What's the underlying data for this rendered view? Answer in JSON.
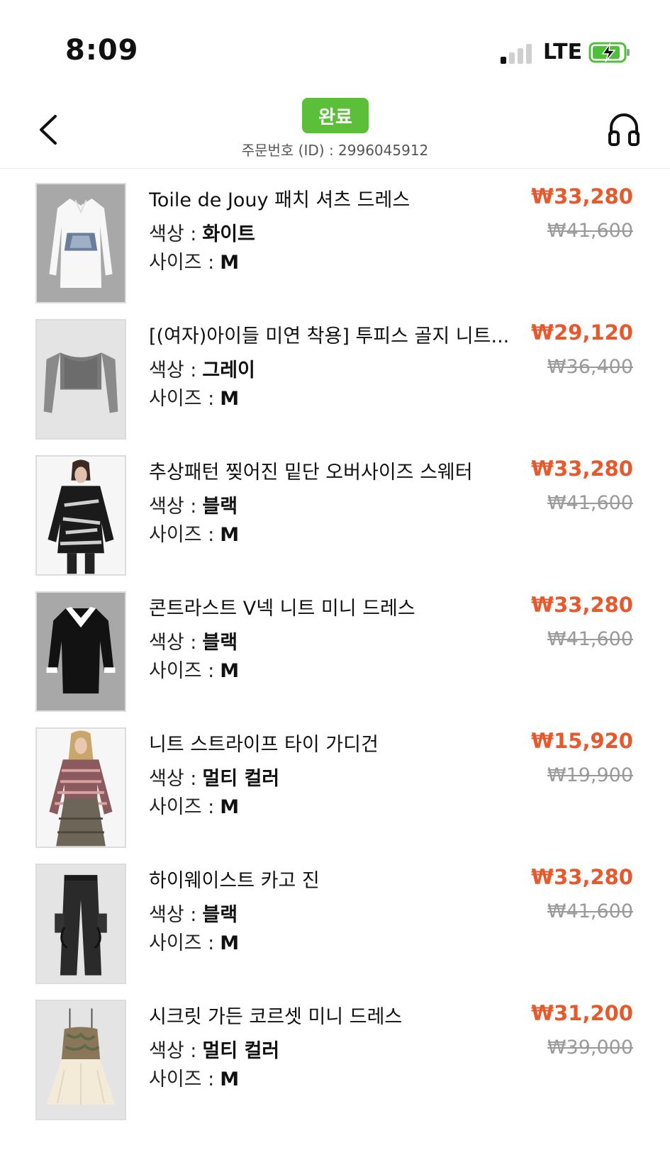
{
  "status_bar": {
    "time": "8:09",
    "network": "LTE"
  },
  "header": {
    "status": "완료",
    "order_id": "주문번호 (ID) : 2996045912",
    "status_color": "#5cbf3a"
  },
  "labels": {
    "color": "색상 :",
    "size": "사이즈 :"
  },
  "items": [
    {
      "name": "Toile de Jouy 패치 셔츠 드레스",
      "color": "화이트",
      "size": "M",
      "price": "₩33,280",
      "original_price": "₩41,600"
    },
    {
      "name": "[(여자)아이들 미연 착용] 투피스 골지 니트...",
      "color": "그레이",
      "size": "M",
      "price": "₩29,120",
      "original_price": "₩36,400"
    },
    {
      "name": "추상패턴 찢어진 밑단 오버사이즈 스웨터",
      "color": "블랙",
      "size": "M",
      "price": "₩33,280",
      "original_price": "₩41,600"
    },
    {
      "name": "콘트라스트 V넥 니트 미니 드레스",
      "color": "블랙",
      "size": "M",
      "price": "₩33,280",
      "original_price": "₩41,600"
    },
    {
      "name": "니트 스트라이프 타이 가디건",
      "color": "멀티 컬러",
      "size": "M",
      "price": "₩15,920",
      "original_price": "₩19,900"
    },
    {
      "name": "하이웨이스트 카고 진",
      "color": "블랙",
      "size": "M",
      "price": "₩33,280",
      "original_price": "₩41,600"
    },
    {
      "name": "시크릿 가든 코르셋 미니 드레스",
      "color": "멀티 컬러",
      "size": "M",
      "price": "₩31,200",
      "original_price": "₩39,000"
    }
  ],
  "colors": {
    "price": "#e8582b",
    "original_price": "#9a9a9a"
  }
}
